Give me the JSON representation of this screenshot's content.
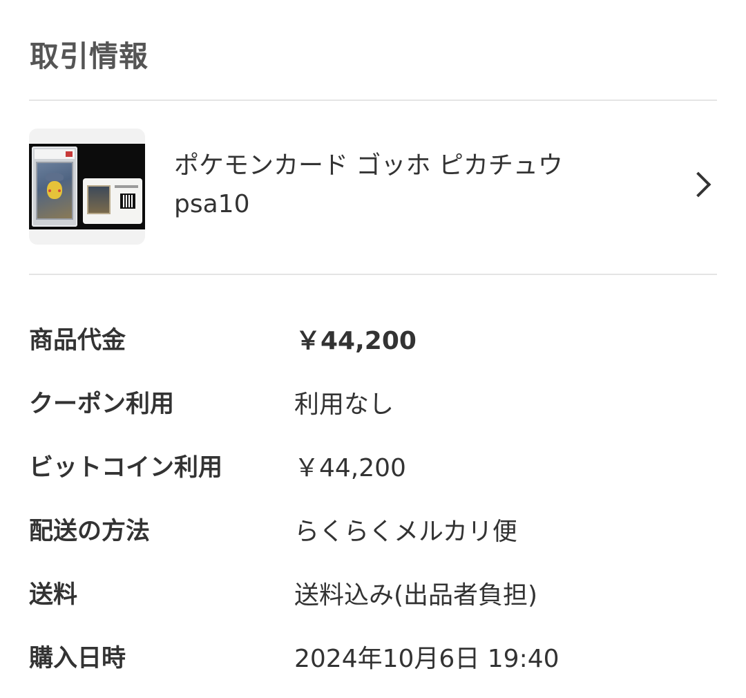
{
  "section": {
    "title": "取引情報"
  },
  "item": {
    "name_line1": "ポケモンカード ゴッホ ピカチュウ",
    "name_line2": "psa10",
    "thumbnail_icon": "product-photo",
    "chevron_icon": "chevron-right-icon"
  },
  "details": [
    {
      "label": "商品代金",
      "value": "￥44,200"
    },
    {
      "label": "クーポン利用",
      "value": "利用なし"
    },
    {
      "label": "ビットコイン利用",
      "value": "￥44,200"
    },
    {
      "label": "配送の方法",
      "value": "らくらくメルカリ便"
    },
    {
      "label": "送料",
      "value": "送料込み(出品者負担)"
    },
    {
      "label": "購入日時",
      "value": "2024年10月6日 19:40"
    }
  ],
  "colors": {
    "text": "#333333",
    "title": "#555555",
    "divider": "#e4e4e4",
    "thumb_bg": "#f2f2f2"
  }
}
